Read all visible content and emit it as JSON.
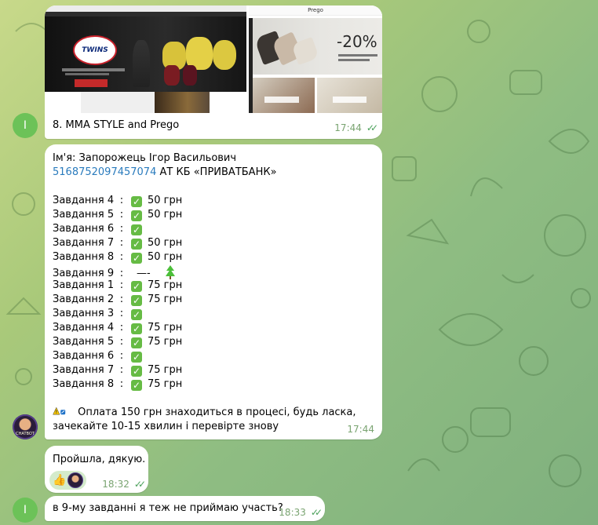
{
  "messages": {
    "m1": {
      "caption": "8. MMA STYLE and Prego",
      "time": "17:44",
      "sender_initial": "I",
      "media": {
        "left_site_logo": "TWINS",
        "right_site_title": "Prego",
        "sale_text": "-20%"
      }
    },
    "m2": {
      "name_line": "Ім'я:  Запорожець Ігор Васильович",
      "card_number": "5168752097457074",
      "bank": "  АТ КБ «ПРИВАТБАНК»",
      "tasks": [
        {
          "label": "Завдання  4",
          "amount": "50 грн",
          "check": true
        },
        {
          "label": "Завдання  5",
          "amount": "50 грн",
          "check": true
        },
        {
          "label": "Завдання  6",
          "amount": "",
          "check": true
        },
        {
          "label": "Завдання  7",
          "amount": "50 грн",
          "check": true
        },
        {
          "label": "Завдання  8",
          "amount": "50 грн",
          "check": true
        },
        {
          "label": "Завдання  9",
          "amount": "—-",
          "check": false,
          "tree": true
        },
        {
          "label": "Завдання  1",
          "amount": "75 грн",
          "check": true
        },
        {
          "label": "Завдання  2",
          "amount": "75 грн",
          "check": true
        },
        {
          "label": "Завдання  3",
          "amount": "",
          "check": true
        },
        {
          "label": "Завдання  4",
          "amount": "75 грн",
          "check": true
        },
        {
          "label": "Завдання  5",
          "amount": "75 грн",
          "check": true
        },
        {
          "label": "Завдання  6",
          "amount": "",
          "check": true
        },
        {
          "label": "Завдання  7",
          "amount": "75 грн",
          "check": true
        },
        {
          "label": "Завдання  8",
          "amount": "75 грн",
          "check": true
        }
      ],
      "colon": ":",
      "status_line1": "Оплата 150 грн знаходиться в процесі, будь ласка,",
      "status_line2": "зачекайте 10-15 хвилин і перевірте знову",
      "time": "17:44",
      "avatar_caption": "CHATBOT"
    },
    "m3": {
      "text": "Пройшла, дякую.",
      "time": "18:32",
      "reaction": "👍"
    },
    "m4": {
      "text": "в 9-му завданні я теж не приймаю участь?",
      "time": "18:33",
      "sender_initial": "I"
    }
  },
  "colors": {
    "link": "#2a7bbd",
    "check_green": "#66bb44",
    "avatar_green": "#6cc258",
    "outgoing_bubble": "#eaf6d6"
  },
  "icons": [
    "double-check-icon",
    "check-mark-icon",
    "tree-icon",
    "warning-icon",
    "thumbs-up-icon"
  ]
}
